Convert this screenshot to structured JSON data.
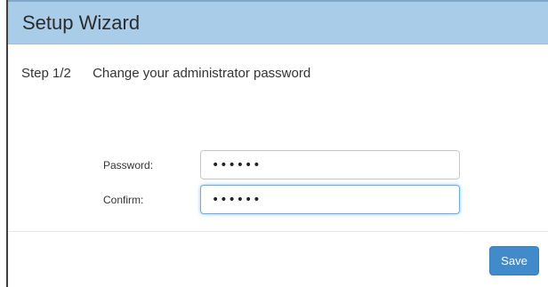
{
  "dialog": {
    "title": "Setup Wizard",
    "step": "Step 1/2",
    "instruction": "Change your administrator password"
  },
  "form": {
    "password_label": "Password:",
    "password_value": "••••••",
    "confirm_label": "Confirm:",
    "confirm_value": "••••••"
  },
  "footer": {
    "save_label": "Save"
  },
  "colors": {
    "header_bg": "#a9cde8",
    "accent": "#428bca",
    "focus_border": "#66afe9"
  }
}
